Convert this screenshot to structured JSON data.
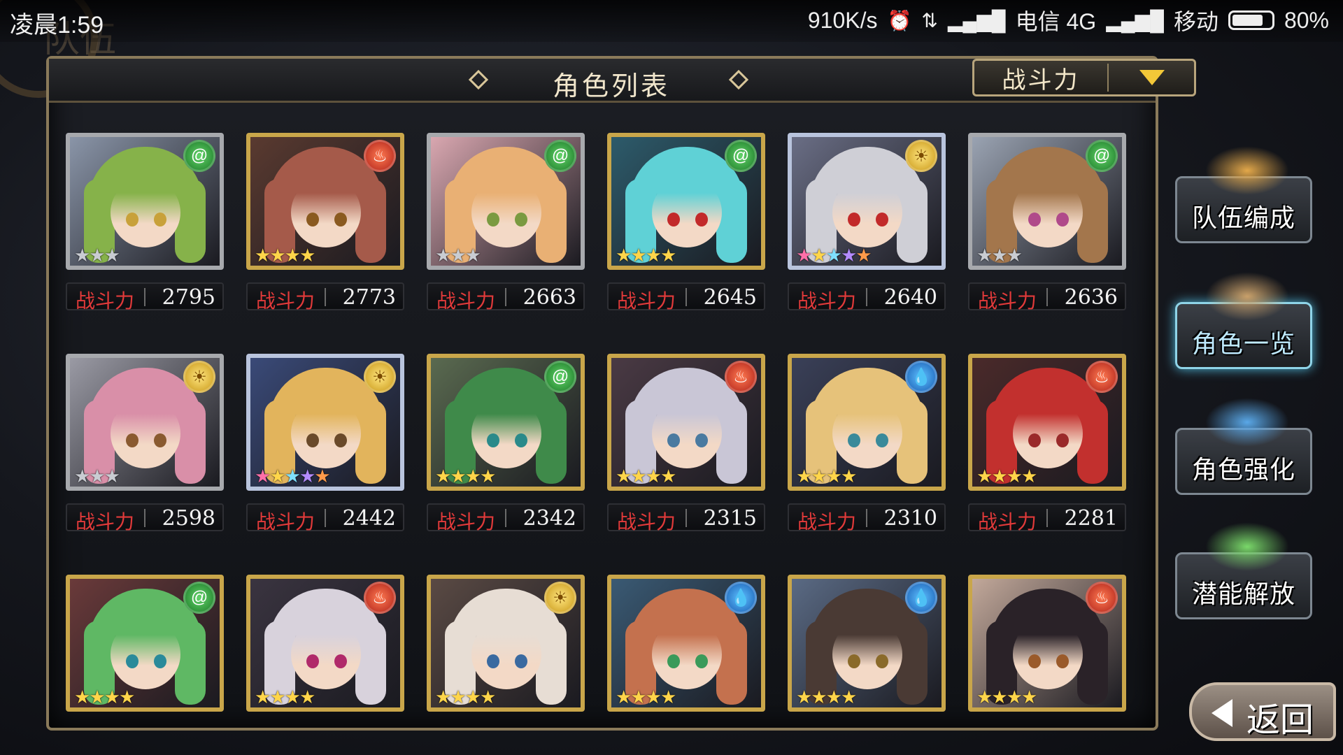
{
  "status_bar": {
    "time": "凌晨1:59",
    "net_speed": "910K/s",
    "carrier1": "电信 4G",
    "carrier2": "移动",
    "battery": "80%",
    "battery_level": 0.8
  },
  "screen_title": "队伍",
  "panel": {
    "title": "角色列表",
    "sort_label": "战斗力"
  },
  "power_label": "战斗力",
  "characters": [
    {
      "power": "2795",
      "attribute": "wind-icon",
      "rarity": 3,
      "frame": "silver",
      "hair": "#86b24a",
      "bg": "#8a95a8",
      "eye": "#c8a13a"
    },
    {
      "power": "2773",
      "attribute": "fire-icon",
      "rarity": 4,
      "frame": "gold",
      "hair": "#a55a4a",
      "bg": "#5a3a30",
      "eye": "#8a5a20"
    },
    {
      "power": "2663",
      "attribute": "wind-icon",
      "rarity": 3,
      "frame": "silver",
      "hair": "#e9b074",
      "bg": "#d9a7b0",
      "eye": "#7a9a40"
    },
    {
      "power": "2645",
      "attribute": "wind-icon",
      "rarity": 4,
      "frame": "gold",
      "hair": "#5fd1d6",
      "bg": "#2d5b6b",
      "eye": "#c22a2a"
    },
    {
      "power": "2640",
      "attribute": "light-icon",
      "rarity": 5,
      "frame": "rainbow",
      "hair": "#cfcfd6",
      "bg": "#6a6e85",
      "eye": "#c22a2a"
    },
    {
      "power": "2636",
      "attribute": "wind-icon",
      "rarity": 3,
      "frame": "silver",
      "hair": "#a3764c",
      "bg": "#9aa3b2",
      "eye": "#b04a8a"
    },
    {
      "power": "2598",
      "attribute": "light-icon",
      "rarity": 3,
      "frame": "silver",
      "hair": "#d98fa8",
      "bg": "#9a9aa4",
      "eye": "#8a5a30"
    },
    {
      "power": "2442",
      "attribute": "light-icon",
      "rarity": 5,
      "frame": "rainbow",
      "hair": "#e2b45c",
      "bg": "#3a4a78",
      "eye": "#6a4a2a"
    },
    {
      "power": "2342",
      "attribute": "wind-icon",
      "rarity": 4,
      "frame": "gold",
      "hair": "#3f8a4a",
      "bg": "#5a6a50",
      "eye": "#2a8a8a"
    },
    {
      "power": "2315",
      "attribute": "fire-icon",
      "rarity": 4,
      "frame": "gold",
      "hair": "#c9c6d6",
      "bg": "#4a3a44",
      "eye": "#4a7aa0"
    },
    {
      "power": "2310",
      "attribute": "water-icon",
      "rarity": 4,
      "frame": "gold",
      "hair": "#e6c27a",
      "bg": "#3a4058",
      "eye": "#3a8a9a"
    },
    {
      "power": "2281",
      "attribute": "fire-icon",
      "rarity": 4,
      "frame": "gold",
      "hair": "#c2302e",
      "bg": "#4a2a2a",
      "eye": "#9a2a2a"
    },
    {
      "power": "",
      "attribute": "wind-icon",
      "rarity": 4,
      "frame": "gold",
      "hair": "#5fb864",
      "bg": "#6a3a3a",
      "eye": "#2a8a9a"
    },
    {
      "power": "",
      "attribute": "fire-icon",
      "rarity": 4,
      "frame": "gold",
      "hair": "#d8d2dc",
      "bg": "#3a3440",
      "eye": "#b02a6a"
    },
    {
      "power": "",
      "attribute": "light-icon",
      "rarity": 4,
      "frame": "gold",
      "hair": "#e7ddd4",
      "bg": "#5a4a44",
      "eye": "#3a6aa0"
    },
    {
      "power": "",
      "attribute": "water-icon",
      "rarity": 4,
      "frame": "gold",
      "hair": "#c4714e",
      "bg": "#3a5a74",
      "eye": "#3a9a5a"
    },
    {
      "power": "",
      "attribute": "water-icon",
      "rarity": 4,
      "frame": "gold",
      "hair": "#4a3a34",
      "bg": "#5a6a84",
      "eye": "#8a6a2a"
    },
    {
      "power": "",
      "attribute": "fire-icon",
      "rarity": 4,
      "frame": "gold",
      "hair": "#2a2228",
      "bg": "#c2a89a",
      "eye": "#9a5a2a"
    }
  ],
  "side_menu": [
    {
      "label": "队伍编成",
      "icon": "team-members-icon",
      "active": false
    },
    {
      "label": "角色一览",
      "icon": "book-icon",
      "active": true
    },
    {
      "label": "角色强化",
      "icon": "enhance-crystal-icon",
      "active": false
    },
    {
      "label": "潜能解放",
      "icon": "potential-orb-icon",
      "active": false
    }
  ],
  "back_button": "返回",
  "colors": {
    "accent_gold": "#c9a64a",
    "power_label_red": "#e23a3a",
    "active_blue": "#8fd4e8"
  }
}
